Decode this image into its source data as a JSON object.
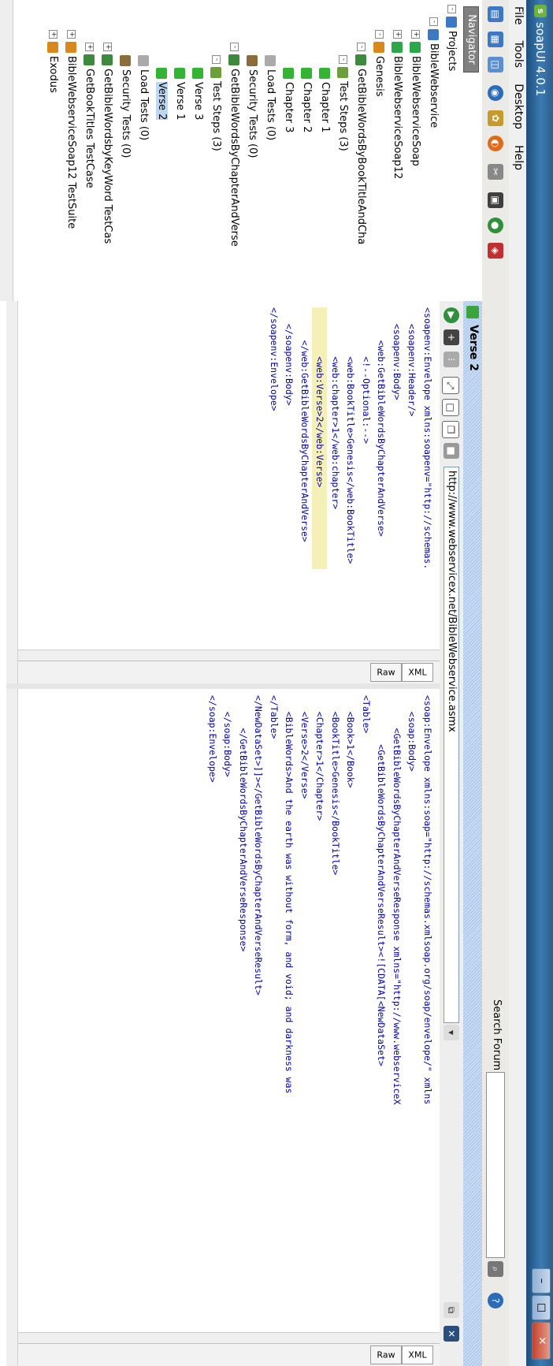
{
  "window": {
    "title": "soapUI 4.0.1"
  },
  "menu": [
    "File",
    "Tools",
    "Desktop",
    "Help"
  ],
  "search": {
    "label": "Search Forum",
    "placeholder": ""
  },
  "navigator": {
    "tab_label": "Navigator"
  },
  "tree": [
    {
      "label": "Projects",
      "icon": "projects-icon",
      "depth": 0,
      "toggle": "-"
    },
    {
      "label": "BibleWebservice",
      "icon": "project-icon",
      "depth": 1,
      "toggle": "-"
    },
    {
      "label": "BibleWebserviceSoap",
      "icon": "interface-icon",
      "depth": 2,
      "toggle": "+"
    },
    {
      "label": "BibleWebserviceSoap12",
      "icon": "interface-icon",
      "depth": 2,
      "toggle": "+"
    },
    {
      "label": "Genesis",
      "icon": "testsuite-icon",
      "depth": 2,
      "toggle": "-"
    },
    {
      "label": "GetBibleWordsByBookTitleAndCha",
      "icon": "testcase-icon",
      "depth": 3,
      "toggle": "-"
    },
    {
      "label": "Test Steps (3)",
      "icon": "teststeps-icon",
      "depth": 4,
      "toggle": "-"
    },
    {
      "label": "Chapter 1",
      "icon": "soap-request-icon",
      "depth": 5,
      "toggle": ""
    },
    {
      "label": "Chapter 2",
      "icon": "soap-request-icon",
      "depth": 5,
      "toggle": ""
    },
    {
      "label": "Chapter 3",
      "icon": "soap-request-icon",
      "depth": 5,
      "toggle": ""
    },
    {
      "label": "Load Tests (0)",
      "icon": "loadtest-icon",
      "depth": 4,
      "toggle": ""
    },
    {
      "label": "Security Tests (0)",
      "icon": "securitytest-icon",
      "depth": 4,
      "toggle": ""
    },
    {
      "label": "GetBibleWordsByChapterAndVerse",
      "icon": "testcase-icon",
      "depth": 3,
      "toggle": "-"
    },
    {
      "label": "Test Steps (3)",
      "icon": "teststeps-icon",
      "depth": 4,
      "toggle": "-"
    },
    {
      "label": "Verse 3",
      "icon": "soap-request-icon",
      "depth": 5,
      "toggle": ""
    },
    {
      "label": "Verse 1",
      "icon": "soap-request-icon",
      "depth": 5,
      "toggle": ""
    },
    {
      "label": "Verse 2",
      "icon": "soap-request-icon",
      "depth": 5,
      "toggle": "",
      "selected": true
    },
    {
      "label": "Load Tests (0)",
      "icon": "loadtest-icon",
      "depth": 4,
      "toggle": ""
    },
    {
      "label": "Security Tests (0)",
      "icon": "securitytest-icon",
      "depth": 4,
      "toggle": ""
    },
    {
      "label": "GetBibleWordsbyKeyWord TestCas",
      "icon": "testcase-icon",
      "depth": 3,
      "toggle": "+"
    },
    {
      "label": "GetBookTitles TestCase",
      "icon": "testcase-icon",
      "depth": 3,
      "toggle": "+"
    },
    {
      "label": "BibleWebserviceSoap12 TestSuite",
      "icon": "testsuite-icon",
      "depth": 2,
      "toggle": "+"
    },
    {
      "label": "Exodus",
      "icon": "testsuite-icon",
      "depth": 2,
      "toggle": "+"
    }
  ],
  "editor": {
    "title": "Verse 2",
    "endpoint": "http://www.webservicex.net/BibleWebservice.asmx",
    "request_tabs": [
      "XML",
      "Raw"
    ],
    "response_tabs": [
      "XML",
      "Raw"
    ],
    "request_lines": [
      "<soapenv:Envelope xmlns:soapenv=\"http://schemas.",
      "   <soapenv:Header/>",
      "   <soapenv:Body>",
      "      <web:GetBibleWordsByChapterAndVerse>",
      "         <!--Optional:-->",
      "         <web:BookTitle>Genesis</web:BookTitle>",
      "         <web:chapter>1</web:chapter>",
      "         <web:Verse>2</web:Verse>",
      "      </web:GetBibleWordsByChapterAndVerse>",
      "   </soapenv:Body>",
      "</soapenv:Envelope>"
    ],
    "response_lines": [
      "<soap:Envelope xmlns:soap=\"http://schemas.xmlsoap.org/soap/envelope/\" xmlns",
      "   <soap:Body>",
      "      <GetBibleWordsByChapterAndVerseResponse xmlns=\"http://www.webserviceX",
      "         <GetBibleWordsByChapterAndVerseResult><![CDATA[<NewDataSet>",
      "<Table>",
      "   <Book>1</Book>",
      "   <BookTitle>Genesis</BookTitle>",
      "   <Chapter>1</Chapter>",
      "   <Verse>2</Verse>",
      "   <BibleWords>And the earth was without form, and void; and darkness was",
      "</Table>",
      "</NewDataSet>]]></GetBibleWordsByChapterAndVerseResult>",
      "      </GetBibleWordsByChapterAndVerseResponse>",
      "   </soap:Body>",
      "</soap:Envelope>"
    ]
  },
  "colors": {
    "titlebar": "#2e5f89",
    "tag": "#0000aa",
    "attr_ns": "#cc00cc",
    "attr_val": "#7a1fa2",
    "highlight": "#f5f0b8",
    "selection": "#bfd6f1"
  }
}
